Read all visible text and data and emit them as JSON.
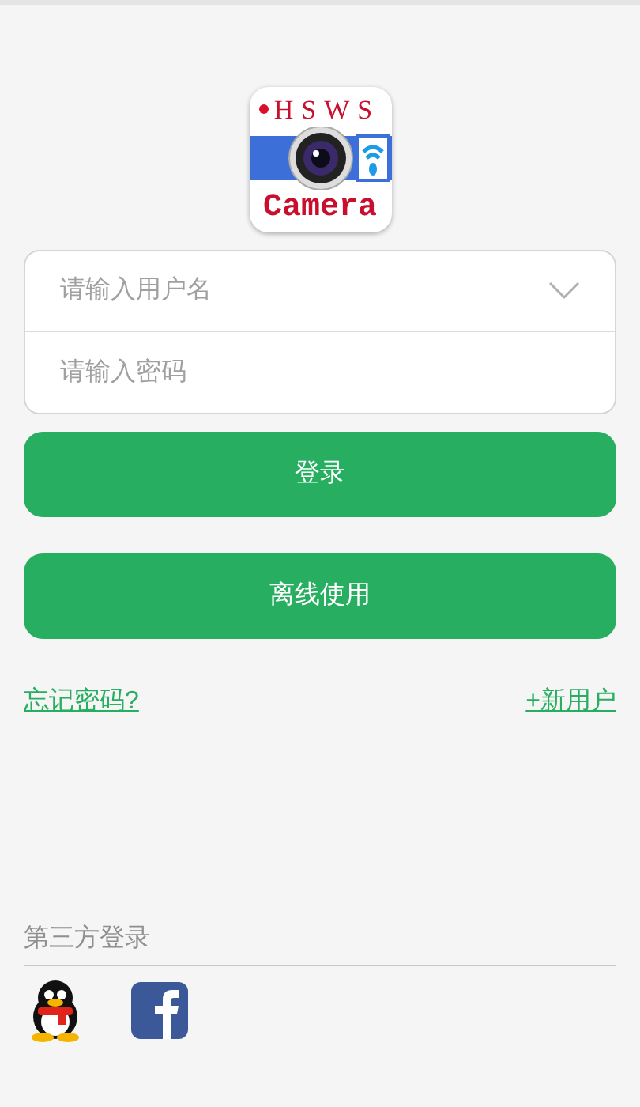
{
  "logo": {
    "top_text": "HSWS",
    "bottom_text": "Camera"
  },
  "login_form": {
    "username": {
      "placeholder": "请输入用户名"
    },
    "password": {
      "placeholder": "请输入密码"
    }
  },
  "buttons": [
    {
      "label": "登录"
    },
    {
      "label": "离线使用"
    }
  ],
  "links": {
    "forgot": "忘记密码?",
    "register": "+新用户"
  },
  "third_party": {
    "title": "第三方登录",
    "providers": [
      {
        "kind": "qq"
      },
      {
        "kind": "facebook"
      }
    ]
  }
}
